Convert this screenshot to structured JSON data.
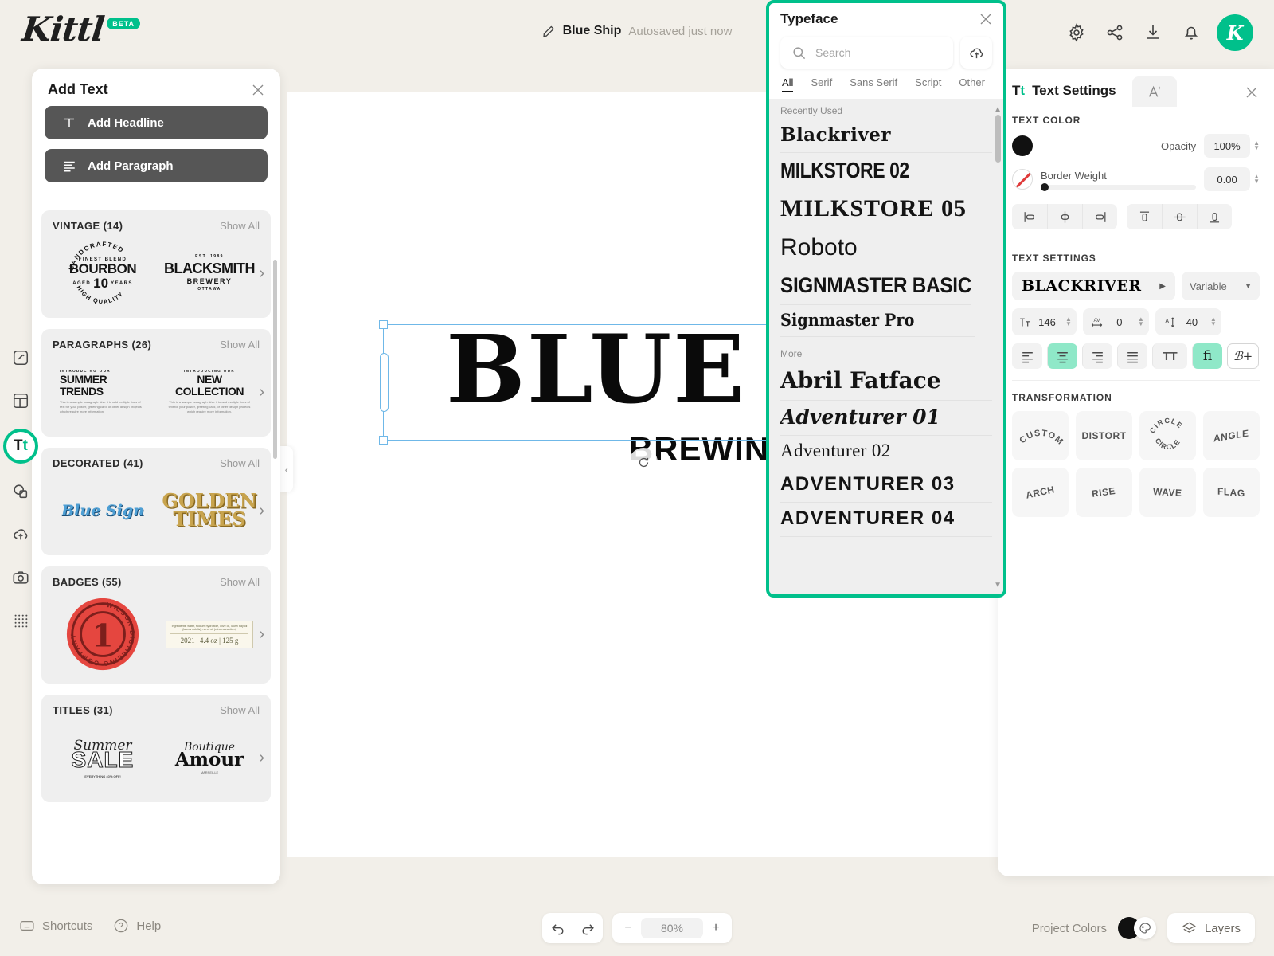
{
  "app": {
    "brand": "Kittl",
    "beta_badge": "BETA"
  },
  "topbar": {
    "doc_title": "Blue Ship",
    "save_status": "Autosaved just now",
    "avatar_letter": "K",
    "icons": [
      "settings-icon",
      "share-icon",
      "download-icon",
      "notifications-icon"
    ]
  },
  "left_rail": {
    "items": [
      {
        "name": "design-tool",
        "icon": "pencil-square-icon",
        "active": false
      },
      {
        "name": "templates-tool",
        "icon": "layout-icon",
        "active": false
      },
      {
        "name": "text-tool",
        "icon": "text-icon",
        "label": "Tt",
        "active": true
      },
      {
        "name": "shapes-tool",
        "icon": "shapes-icon",
        "active": false
      },
      {
        "name": "uploads-tool",
        "icon": "cloud-upload-icon",
        "active": false
      },
      {
        "name": "photos-tool",
        "icon": "camera-icon",
        "active": false
      },
      {
        "name": "patterns-tool",
        "icon": "grid-dots-icon",
        "active": false
      }
    ]
  },
  "add_text_panel": {
    "title": "Add Text",
    "add_headline_label": "Add Headline",
    "add_paragraph_label": "Add Paragraph",
    "show_all_label": "Show All",
    "categories": [
      {
        "name": "VINTAGE (14)",
        "thumbs": [
          {
            "kind": "vintage-bourbon",
            "arc_top": "HANDCRAFTED",
            "line1": "FINEST BLEND",
            "line2": "BOURBON",
            "line3a": "AGED",
            "line3b": "10",
            "line3c": "YEARS",
            "arc_bottom": "HIGH QUALITY"
          },
          {
            "kind": "vintage-blacksmith",
            "line1": "EST. 1989",
            "line2": "BLACKSMITH",
            "line3": "BREWERY",
            "line4": "OTTAWA"
          }
        ]
      },
      {
        "name": "PARAGRAPHS (26)",
        "thumbs": [
          {
            "kind": "paragraph",
            "eyebrow": "INTRODUCING OUR",
            "title": "SUMMER TRENDS",
            "body": "This is a sample paragraph. Use it to add multiple lines of text for your poster, greeting card, or other design projects which require more information."
          },
          {
            "kind": "paragraph-center",
            "eyebrow": "INTRODUCING OUR",
            "title": "NEW COLLECTION",
            "body": "This is a sample paragraph. Use it to add multiple lines of text for your poster, greeting card, or other design projects which require more information."
          }
        ]
      },
      {
        "name": "DECORATED (41)",
        "thumbs": [
          {
            "kind": "decorated-blue",
            "text": "Blue Sign"
          },
          {
            "kind": "decorated-gold",
            "line1": "GOLDEN",
            "line2": "TIMES"
          }
        ]
      },
      {
        "name": "BADGES (55)",
        "thumbs": [
          {
            "kind": "badge-seal",
            "arc_text": "WILSON DISTILLING COMPANY",
            "center": "1"
          },
          {
            "kind": "badge-label",
            "body": "Ingredients: water, sodium hydroxide, olive oil, laurel bay oil (laurus nobilis), neroli oil (citrus aurantium)",
            "footer": "2021 | 4.4 oz | 125 g"
          }
        ]
      },
      {
        "name": "TITLES (31)",
        "thumbs": [
          {
            "kind": "title-sale",
            "script": "Summer",
            "big": "SALE",
            "footer": "EVERYTHING 40% OFF!"
          },
          {
            "kind": "title-amour",
            "script": "Boutique",
            "big": "Amour",
            "footer": "MARSEILLE"
          }
        ]
      }
    ]
  },
  "canvas": {
    "headline": "BLUE SHIP",
    "subline": "BREWING CO."
  },
  "typeface_panel": {
    "title": "Typeface",
    "search_placeholder": "Search",
    "search_value": "",
    "upload_icon": "cloud-upload-icon",
    "tabs": [
      {
        "label": "All",
        "active": true
      },
      {
        "label": "Serif",
        "active": false
      },
      {
        "label": "Sans Serif",
        "active": false
      },
      {
        "label": "Script",
        "active": false
      },
      {
        "label": "Other",
        "active": false
      }
    ],
    "groups": [
      {
        "label": "Recently Used",
        "fonts": [
          {
            "name": "Blackriver",
            "class": "f-blackriver"
          },
          {
            "name": "MILKSTORE 02",
            "class": "f-milk02"
          },
          {
            "name": "MILKSTORE 05",
            "class": "f-milk05"
          },
          {
            "name": "Roboto",
            "class": "f-roboto"
          },
          {
            "name": "SIGNMASTER BASIC",
            "class": "f-signbasic"
          },
          {
            "name": "Signmaster Pro",
            "class": "f-signpro"
          }
        ]
      },
      {
        "label": "More",
        "fonts": [
          {
            "name": "Abril Fatface",
            "class": "f-abril"
          },
          {
            "name": "Adventurer 01",
            "class": "f-adv01"
          },
          {
            "name": "Adventurer 02",
            "class": "f-adv02"
          },
          {
            "name": "ADVENTURER 03",
            "class": "f-adv03"
          },
          {
            "name": "ADVENTURER 04",
            "class": "f-adv04"
          }
        ]
      }
    ]
  },
  "text_settings": {
    "tab_label": "Text Settings",
    "tab_icon": "text-icon",
    "ai_tab_icon": "ai-text-effects-icon",
    "text_color_label": "TEXT COLOR",
    "text_color_hex": "#111111",
    "opacity_label": "Opacity",
    "opacity_value": "100%",
    "border_weight_label": "Border Weight",
    "border_weight_value": "0.00",
    "border_color": "none",
    "align_icons": [
      "align-left-icon",
      "align-center-horizontal-icon",
      "align-right-icon",
      "align-top-icon",
      "align-center-vertical-icon",
      "align-bottom-icon"
    ],
    "settings_label": "TEXT SETTINGS",
    "font_name": "BLACKRIVER",
    "font_variant": "Variable",
    "font_size": "146",
    "letter_spacing": "0",
    "line_height": "40",
    "paragraph_align": [
      {
        "icon": "text-align-left-icon",
        "active": false
      },
      {
        "icon": "text-align-center-icon",
        "active": true
      },
      {
        "icon": "text-align-right-icon",
        "active": false
      },
      {
        "icon": "text-align-justify-icon",
        "active": false
      }
    ],
    "uppercase_label": "TT",
    "ligature_label": "fi",
    "ligature_active": true,
    "more_type_label": "ℬ+",
    "transformation_label": "TRANSFORMATION",
    "transformations": [
      {
        "label": "CUSTOM",
        "style": "arch"
      },
      {
        "label": "DISTORT",
        "style": "flat"
      },
      {
        "label": "CIRCLE",
        "style": "circle"
      },
      {
        "label": "ANGLE",
        "style": "angle"
      },
      {
        "label": "ARCH",
        "style": "arch-small"
      },
      {
        "label": "RISE",
        "style": "rise"
      },
      {
        "label": "WAVE",
        "style": "wave"
      },
      {
        "label": "FLAG",
        "style": "flag"
      }
    ]
  },
  "bottombar": {
    "shortcuts_label": "Shortcuts",
    "help_label": "Help",
    "undo_icon": "undo-arrow-icon",
    "redo_icon": "redo-arrow-icon",
    "zoom_out_label": "−",
    "zoom_value": "80%",
    "zoom_in_label": "+",
    "project_colors_label": "Project Colors",
    "project_color_hex": "#111111",
    "layers_label": "Layers"
  }
}
